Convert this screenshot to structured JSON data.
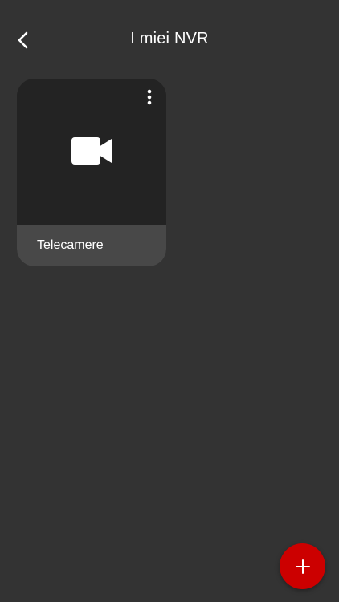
{
  "header": {
    "title": "I miei NVR",
    "back_icon": "chevron-left-icon"
  },
  "devices": [
    {
      "label": "Telecamere",
      "icon": "video-camera-icon",
      "menu_icon": "more-vertical-icon"
    }
  ],
  "fab": {
    "icon": "plus-icon"
  },
  "colors": {
    "background": "#333333",
    "card_preview": "#232323",
    "card_footer": "#484848",
    "accent": "#cc0000",
    "text": "#ffffff"
  }
}
